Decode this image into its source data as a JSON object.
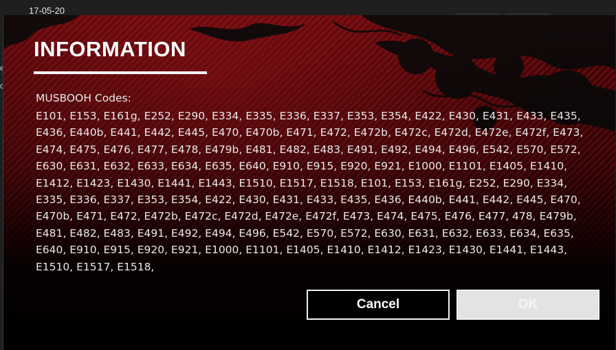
{
  "background": {
    "date_fragment": "17-05-20",
    "left_fragment_1": "e",
    "left_fragment_2": "c"
  },
  "dialog": {
    "title": "INFORMATION",
    "heading": "MUSBOOH Codes:",
    "codes": "E101, E153, E161g, E252, E290, E334, E335, E336, E337, E353, E354, E422, E430, E431, E433, E435, E436, E440b, E441, E442, E445, E470, E470b, E471, E472, E472b, E472c, E472d, E472e, E472f, E473, E474, E475, E476, E477, E478, E479b, E481, E482, E483, E491, E492, E494, E496, E542, E570, E572, E630, E631, E632, E633, E634, E635, E640, E910, E915, E920, E921, E1000, E1101, E1405, E1410, E1412, E1423, E1430, E1441, E1443, E1510, E1517, E1518, E101, E153, E161g, E252, E290, E334, E335, E336, E337, E353, E354, E422, E430, E431, E433, E435, E436, E440b, E441, E442, E445, E470, E470b, E471, E472, E472b, E472c, E472d, E472e, E472f, E473, E474, E475, E476, E477, 478, E479b, E481, E482, E483, E491, E492, E494, E496, E542, E570, E572, E630, E631, E632, E633, E634, E635, E640, E910, E915, E920, E921, E1000, E1101, E1405, E1410, E1412, E1423, E1430, E1441, E1443, E1510, E1517, E1518,",
    "cancel_label": "Cancel",
    "ok_label": "OK"
  },
  "colors": {
    "accent_red": "#8a0f14",
    "dialog_bg": "#0c0c0c",
    "ok_disabled_bg": "#e3e3e3"
  }
}
